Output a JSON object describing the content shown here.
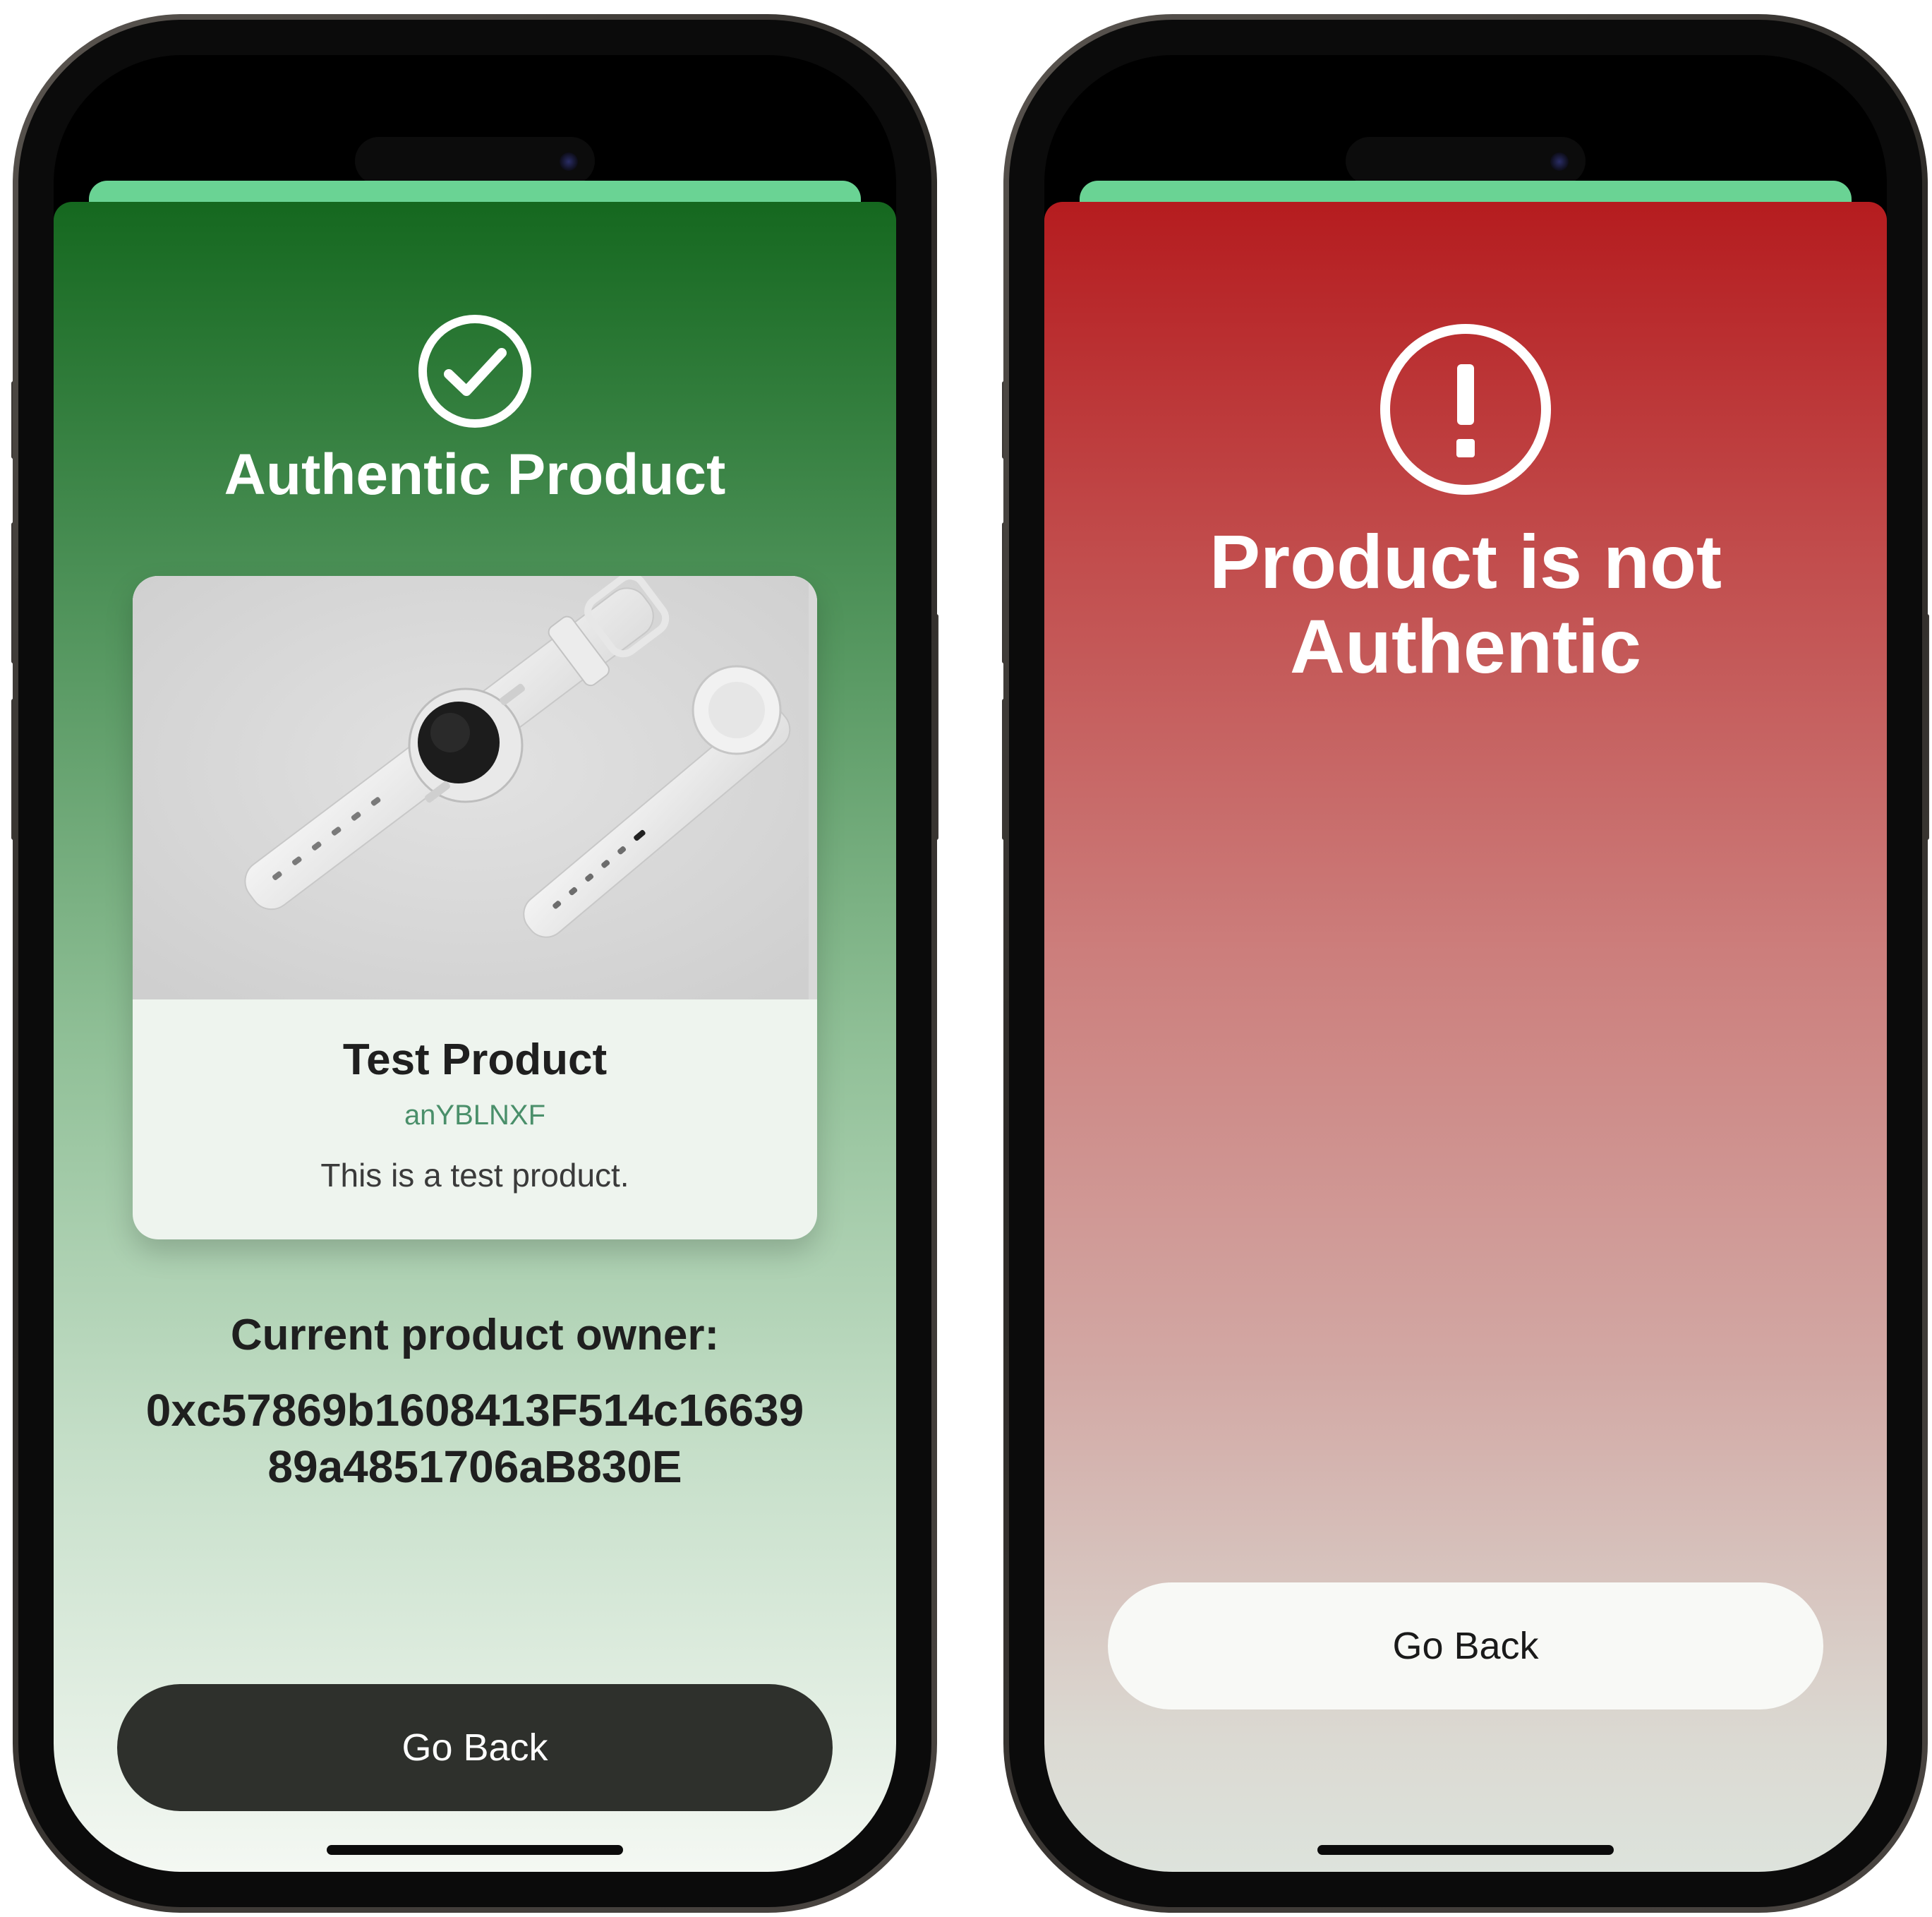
{
  "left_screen": {
    "status_icon": "checkmark-circle-icon",
    "title": "Authentic Product",
    "product": {
      "image": "white-smartwatches-image",
      "name": "Test Product",
      "id": "anYBLNXF",
      "description": "This is a test product."
    },
    "owner_label": "Current product owner:",
    "owner_address_line1": "0xc57869b1608413F514c16639",
    "owner_address_line2": "89a4851706aB830E",
    "go_back_label": "Go Back"
  },
  "right_screen": {
    "status_icon": "exclamation-circle-icon",
    "title_line1": "Product is not",
    "title_line2": "Authentic",
    "go_back_label": "Go Back"
  },
  "colors": {
    "success_sheet_top": "#15681f",
    "error_sheet_top": "#b51c1f",
    "sheet_peek": "#6ad394",
    "dark_button": "#2e302c",
    "product_id_text": "#4a8f6a"
  }
}
